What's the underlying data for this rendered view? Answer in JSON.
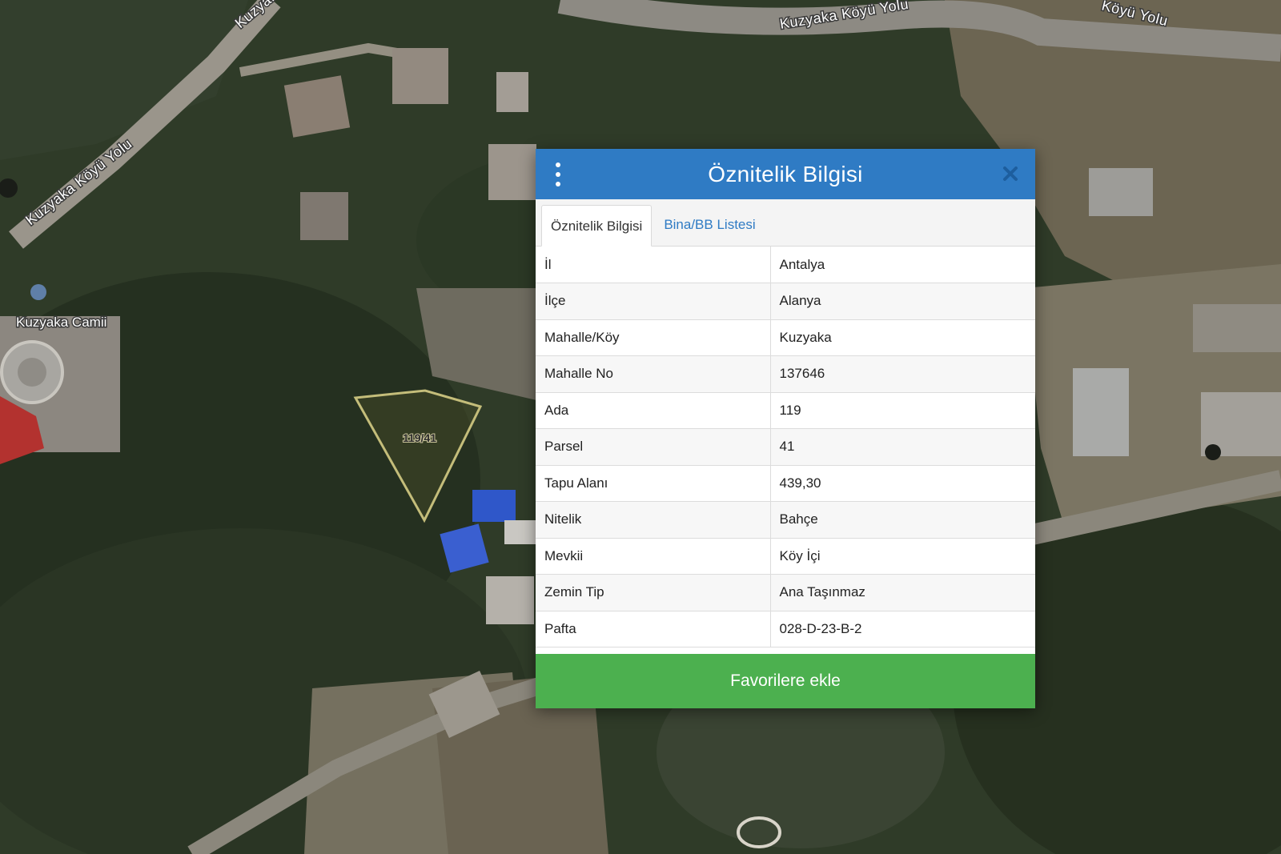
{
  "map": {
    "road_labels": [
      "Kuzyaka Köyü Yolu",
      "Kuzyaka Köyü Yolu",
      "Köyü Yolu",
      "Kuzyaka"
    ],
    "place_label": "Kuzyaka Camii",
    "parcel_label": "119/41",
    "parcel_outline_color": "#c4bd7a"
  },
  "dialog": {
    "title": "Öznitelik Bilgisi",
    "menu_icon": "vertical-ellipsis",
    "close_icon": "close-x",
    "header_color": "#2f7bc4",
    "tabs": [
      {
        "label": "Öznitelik Bilgisi",
        "active": true
      },
      {
        "label": "Bina/BB Listesi",
        "active": false
      }
    ],
    "rows": [
      {
        "key": "İl",
        "value": "Antalya"
      },
      {
        "key": "İlçe",
        "value": "Alanya"
      },
      {
        "key": "Mahalle/Köy",
        "value": "Kuzyaka"
      },
      {
        "key": "Mahalle No",
        "value": "137646"
      },
      {
        "key": "Ada",
        "value": "119"
      },
      {
        "key": "Parsel",
        "value": "41"
      },
      {
        "key": "Tapu Alanı",
        "value": "439,30"
      },
      {
        "key": "Nitelik",
        "value": "Bahçe"
      },
      {
        "key": "Mevkii",
        "value": "Köy İçi"
      },
      {
        "key": "Zemin Tip",
        "value": "Ana Taşınmaz"
      },
      {
        "key": "Pafta",
        "value": "028-D-23-B-2"
      }
    ],
    "favorite_button": "Favorilere ekle",
    "favorite_color": "#4cb04f"
  }
}
